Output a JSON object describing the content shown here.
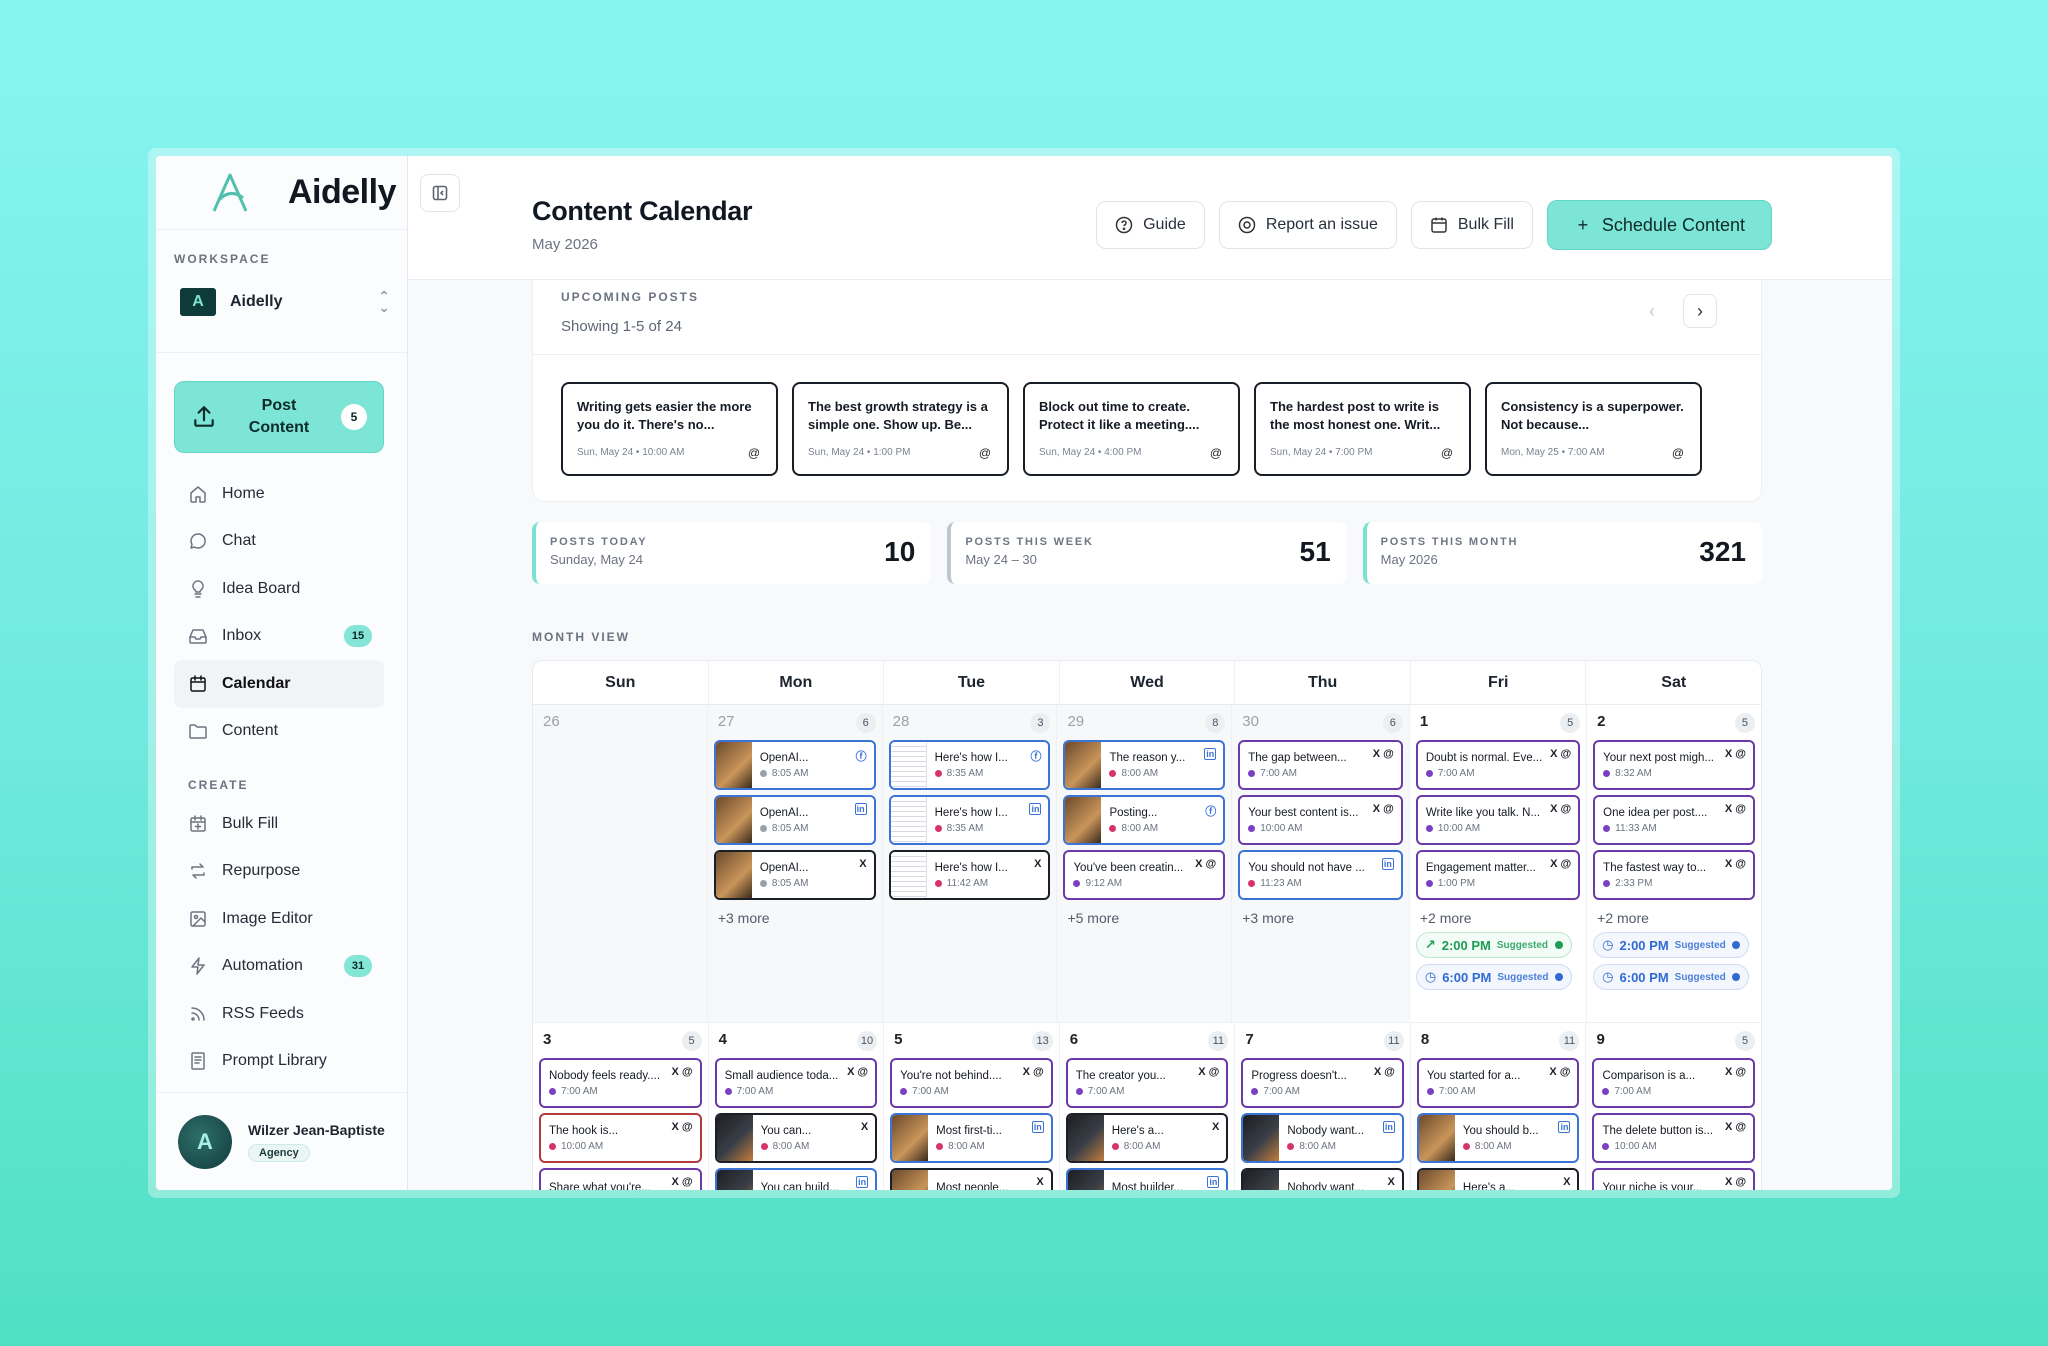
{
  "brand": {
    "name": "Aidelly"
  },
  "sidebar": {
    "workspace_label": "WORKSPACE",
    "workspace_name": "Aidelly",
    "post_button": {
      "label": "Post Content",
      "count": "5"
    },
    "nav": [
      {
        "label": "Home",
        "icon": "home-icon"
      },
      {
        "label": "Chat",
        "icon": "chat-icon"
      },
      {
        "label": "Idea Board",
        "icon": "lightbulb-icon"
      },
      {
        "label": "Inbox",
        "icon": "inbox-icon",
        "badge": "15"
      },
      {
        "label": "Calendar",
        "icon": "calendar-icon",
        "active": true
      },
      {
        "label": "Content",
        "icon": "folder-icon"
      }
    ],
    "create_label": "CREATE",
    "create": [
      {
        "label": "Bulk Fill",
        "icon": "calendar-plus-icon"
      },
      {
        "label": "Repurpose",
        "icon": "repeat-icon"
      },
      {
        "label": "Image Editor",
        "icon": "image-icon"
      },
      {
        "label": "Automation",
        "icon": "lightning-icon",
        "badge": "31"
      },
      {
        "label": "RSS Feeds",
        "icon": "rss-icon"
      },
      {
        "label": "Prompt Library",
        "icon": "book-icon"
      }
    ],
    "user": {
      "name": "Wilzer Jean-Baptiste",
      "role": "Agency"
    }
  },
  "header": {
    "title": "Content Calendar",
    "subtitle": "May 2026",
    "guide": "Guide",
    "report": "Report an issue",
    "bulk": "Bulk Fill",
    "schedule": "Schedule Content"
  },
  "upcoming": {
    "label": "UPCOMING POSTS",
    "showing": "Showing 1-5 of 24",
    "cards": [
      {
        "text": "Writing gets easier the more you do it. There's no...",
        "meta": "Sun, May 24 • 10:00 AM"
      },
      {
        "text": "The best growth strategy is a simple one. Show up. Be...",
        "meta": "Sun, May 24 • 1:00 PM"
      },
      {
        "text": "Block out time to create. Protect it like a meeting....",
        "meta": "Sun, May 24 • 4:00 PM"
      },
      {
        "text": "The hardest post to write is the most honest one. Writ...",
        "meta": "Sun, May 24 • 7:00 PM"
      },
      {
        "text": "Consistency is a superpower. Not because...",
        "meta": "Mon, May 25 • 7:00 AM"
      }
    ]
  },
  "stats": [
    {
      "label": "POSTS TODAY",
      "sub": "Sunday, May 24",
      "value": "10"
    },
    {
      "label": "POSTS THIS WEEK",
      "sub": "May 24 – 30",
      "value": "51"
    },
    {
      "label": "POSTS THIS MONTH",
      "sub": "May 2026",
      "value": "321"
    }
  ],
  "calendar": {
    "label": "MONTH VIEW",
    "days": [
      "Sun",
      "Mon",
      "Tue",
      "Wed",
      "Thu",
      "Fri",
      "Sat"
    ],
    "week1": [
      {
        "num": "26",
        "count": "",
        "muted": true,
        "posts": []
      },
      {
        "num": "27",
        "count": "6",
        "muted": true,
        "more": "+3 more",
        "posts": [
          {
            "title": "OpenAI...",
            "time": "8:05 AM",
            "icons": "fb",
            "border": "blue",
            "thumb": "photo",
            "dot": "gray"
          },
          {
            "title": "OpenAI...",
            "time": "8:05 AM",
            "icons": "li",
            "border": "blue",
            "thumb": "photo",
            "dot": "gray"
          },
          {
            "title": "OpenAI...",
            "time": "8:05 AM",
            "icons": "x",
            "border": "black",
            "thumb": "photo",
            "dot": "gray"
          }
        ]
      },
      {
        "num": "28",
        "count": "3",
        "muted": true,
        "posts": [
          {
            "title": "Here's how I...",
            "time": "8:35 AM",
            "icons": "fb",
            "border": "blue",
            "thumb": "doc",
            "dot": "pink"
          },
          {
            "title": "Here's how I...",
            "time": "8:35 AM",
            "icons": "li",
            "border": "blue",
            "thumb": "doc",
            "dot": "pink"
          },
          {
            "title": "Here's how I...",
            "time": "11:42 AM",
            "icons": "x",
            "border": "black",
            "thumb": "doc",
            "dot": "pink"
          }
        ]
      },
      {
        "num": "29",
        "count": "8",
        "muted": true,
        "more": "+5 more",
        "posts": [
          {
            "title": "The reason y...",
            "time": "8:00 AM",
            "icons": "li",
            "border": "blue",
            "thumb": "photo",
            "dot": "pink"
          },
          {
            "title": "Posting...",
            "time": "8:00 AM",
            "icons": "fb",
            "border": "blue",
            "thumb": "photo",
            "dot": "pink"
          },
          {
            "title": "You've been creatin...",
            "time": "9:12 AM",
            "icons": "x@",
            "border": "purple",
            "thumb": "",
            "dot": "purple"
          }
        ]
      },
      {
        "num": "30",
        "count": "6",
        "muted": true,
        "more": "+3 more",
        "posts": [
          {
            "title": "The gap between...",
            "time": "7:00 AM",
            "icons": "x@",
            "border": "purple",
            "thumb": "",
            "dot": "purple"
          },
          {
            "title": "Your best content is...",
            "time": "10:00 AM",
            "icons": "x@",
            "border": "purple",
            "thumb": "",
            "dot": "purple"
          },
          {
            "title": "You should not have ...",
            "time": "11:23 AM",
            "icons": "li",
            "border": "blue",
            "thumb": "",
            "dot": "pink"
          }
        ]
      },
      {
        "num": "1",
        "count": "5",
        "muted": false,
        "more": "+2 more",
        "sugg": [
          {
            "time": "2:00 PM",
            "tag": "Suggested",
            "color": "green",
            "icon": "↗"
          },
          {
            "time": "6:00 PM",
            "tag": "Suggested",
            "color": "blue",
            "icon": "◷"
          }
        ],
        "posts": [
          {
            "title": "Doubt is normal. Eve...",
            "time": "7:00 AM",
            "icons": "x@",
            "border": "purple",
            "thumb": "",
            "dot": "purple"
          },
          {
            "title": "Write like you talk. N...",
            "time": "10:00 AM",
            "icons": "x@",
            "border": "purple",
            "thumb": "",
            "dot": "purple"
          },
          {
            "title": "Engagement matter...",
            "time": "1:00 PM",
            "icons": "x@",
            "border": "purple",
            "thumb": "",
            "dot": "purple"
          }
        ]
      },
      {
        "num": "2",
        "count": "5",
        "muted": false,
        "more": "+2 more",
        "sugg": [
          {
            "time": "2:00 PM",
            "tag": "Suggested",
            "color": "blue",
            "icon": "◷"
          },
          {
            "time": "6:00 PM",
            "tag": "Suggested",
            "color": "blue",
            "icon": "◷"
          }
        ],
        "posts": [
          {
            "title": "Your next post migh...",
            "time": "8:32 AM",
            "icons": "x@",
            "border": "purple",
            "thumb": "",
            "dot": "purple"
          },
          {
            "title": "One idea per post....",
            "time": "11:33 AM",
            "icons": "x@",
            "border": "purple",
            "thumb": "",
            "dot": "purple"
          },
          {
            "title": "The fastest way to...",
            "time": "2:33 PM",
            "icons": "x@",
            "border": "purple",
            "thumb": "",
            "dot": "purple"
          }
        ]
      }
    ],
    "week2": [
      {
        "num": "3",
        "count": "5",
        "posts": [
          {
            "title": "Nobody feels ready....",
            "time": "7:00 AM",
            "icons": "x@",
            "border": "purple",
            "thumb": "",
            "dot": "purple"
          },
          {
            "title": "The hook is...",
            "time": "10:00 AM",
            "icons": "x@",
            "border": "red",
            "thumb": "",
            "dot": "pink"
          },
          {
            "title": "Share what you're...",
            "time": "",
            "icons": "x@",
            "border": "purple",
            "thumb": "",
            "dot": "purple"
          }
        ]
      },
      {
        "num": "4",
        "count": "10",
        "posts": [
          {
            "title": "Small audience toda...",
            "time": "7:00 AM",
            "icons": "x@",
            "border": "purple",
            "thumb": "",
            "dot": "purple"
          },
          {
            "title": "You can...",
            "time": "8:00 AM",
            "icons": "x",
            "border": "black",
            "thumb": "dark",
            "dot": "pink"
          },
          {
            "title": "You can build...",
            "time": "",
            "icons": "li",
            "border": "blue",
            "thumb": "dark",
            "dot": "pink"
          }
        ]
      },
      {
        "num": "5",
        "count": "13",
        "posts": [
          {
            "title": "You're not behind....",
            "time": "7:00 AM",
            "icons": "x@",
            "border": "purple",
            "thumb": "",
            "dot": "purple"
          },
          {
            "title": "Most first-ti...",
            "time": "8:00 AM",
            "icons": "li",
            "border": "blue",
            "thumb": "photo",
            "dot": "pink"
          },
          {
            "title": "Most people...",
            "time": "",
            "icons": "x",
            "border": "black",
            "thumb": "photo",
            "dot": "pink"
          }
        ]
      },
      {
        "num": "6",
        "count": "11",
        "posts": [
          {
            "title": "The creator you...",
            "time": "7:00 AM",
            "icons": "x@",
            "border": "purple",
            "thumb": "",
            "dot": "purple"
          },
          {
            "title": "Here's a...",
            "time": "8:00 AM",
            "icons": "x",
            "border": "black",
            "thumb": "dark",
            "dot": "pink"
          },
          {
            "title": "Most builder...",
            "time": "",
            "icons": "li",
            "border": "blue",
            "thumb": "dark",
            "dot": "pink"
          }
        ]
      },
      {
        "num": "7",
        "count": "11",
        "posts": [
          {
            "title": "Progress doesn't...",
            "time": "7:00 AM",
            "icons": "x@",
            "border": "purple",
            "thumb": "",
            "dot": "purple"
          },
          {
            "title": "Nobody want...",
            "time": "8:00 AM",
            "icons": "li",
            "border": "blue",
            "thumb": "dark",
            "dot": "pink"
          },
          {
            "title": "Nobody want...",
            "time": "",
            "icons": "x",
            "border": "black",
            "thumb": "dark",
            "dot": "pink"
          }
        ]
      },
      {
        "num": "8",
        "count": "11",
        "posts": [
          {
            "title": "You started for a...",
            "time": "7:00 AM",
            "icons": "x@",
            "border": "purple",
            "thumb": "",
            "dot": "purple"
          },
          {
            "title": "You should b...",
            "time": "8:00 AM",
            "icons": "li",
            "border": "blue",
            "thumb": "photo",
            "dot": "pink"
          },
          {
            "title": "Here's a...",
            "time": "",
            "icons": "x",
            "border": "black",
            "thumb": "photo",
            "dot": "pink"
          }
        ]
      },
      {
        "num": "9",
        "count": "5",
        "posts": [
          {
            "title": "Comparison is a...",
            "time": "7:00 AM",
            "icons": "x@",
            "border": "purple",
            "thumb": "",
            "dot": "purple"
          },
          {
            "title": "The delete button is...",
            "time": "10:00 AM",
            "icons": "x@",
            "border": "purple",
            "thumb": "",
            "dot": "purple"
          },
          {
            "title": "Your niche is your...",
            "time": "",
            "icons": "x@",
            "border": "purple",
            "thumb": "",
            "dot": "purple"
          }
        ]
      }
    ]
  }
}
